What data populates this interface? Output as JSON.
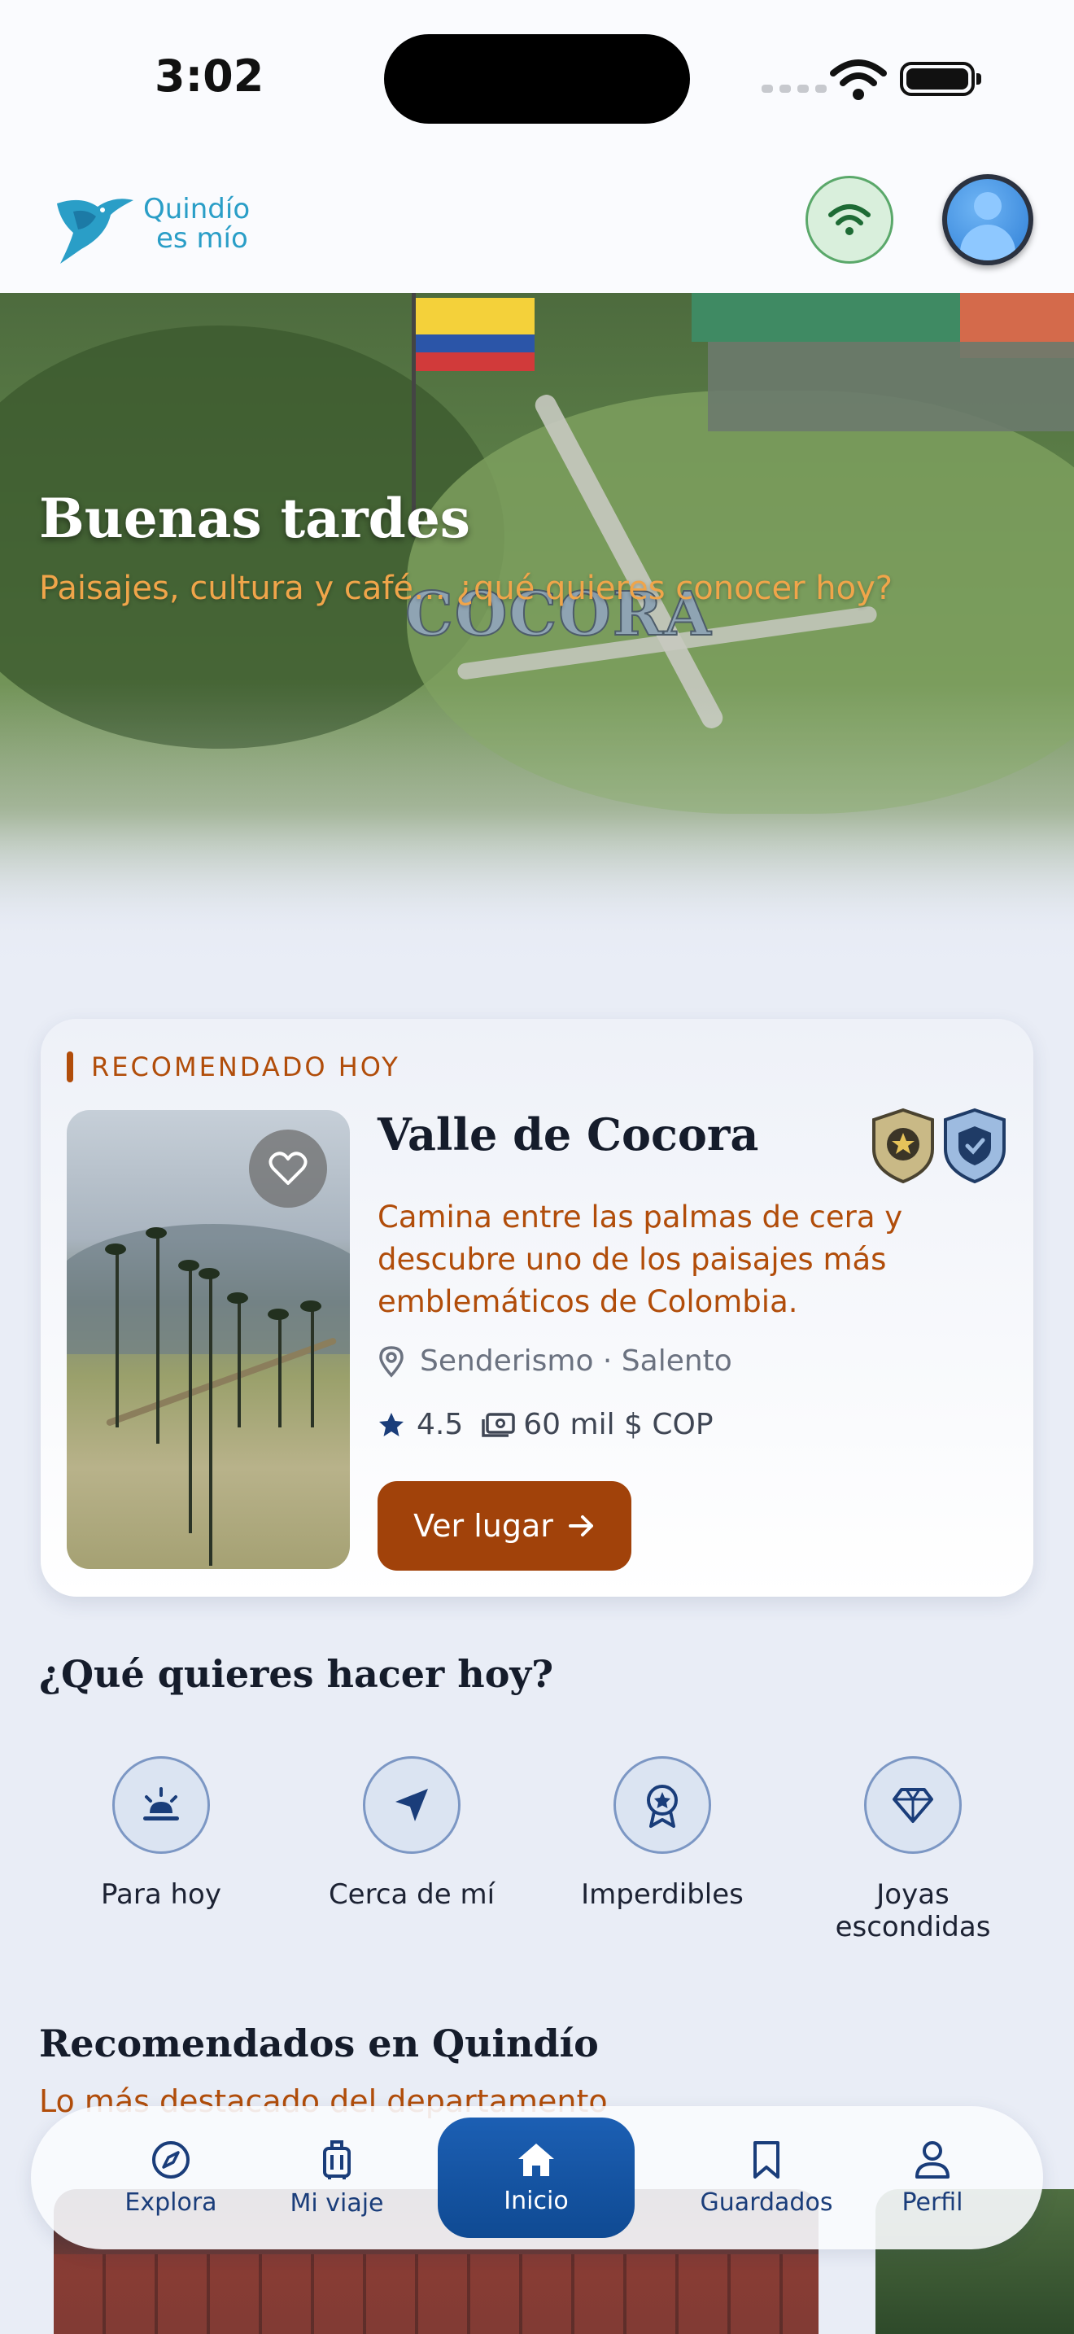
{
  "status_bar": {
    "time": "3:02"
  },
  "header": {
    "logo": {
      "line1": "Quindío",
      "line2": "es mío"
    }
  },
  "hero": {
    "title": "Buenas tardes",
    "subtitle": "Paisajes, cultura y café… ¿qué quieres conocer hoy?",
    "sign_text": "COCORA"
  },
  "recommended": {
    "tag": "RECOMENDADO HOY",
    "title": "Valle de Cocora",
    "description": "Camina entre las palmas de cera y descubre uno de los paisajes más emblemáticos de Colombia.",
    "meta": "Senderismo · Salento",
    "rating": "4.5",
    "price": "60 mil $ COP",
    "button_label": "Ver lugar"
  },
  "quick_actions": {
    "title": "¿Qué quieres hacer hoy?",
    "items": [
      {
        "label": "Para hoy",
        "icon": "sunset-icon"
      },
      {
        "label": "Cerca de mí",
        "icon": "navigation-arrow-icon"
      },
      {
        "label": "Imperdibles",
        "icon": "award-ribbon-icon"
      },
      {
        "label": "Joyas escondidas",
        "icon": "diamond-icon"
      }
    ]
  },
  "section": {
    "title": "Recomendados en Quindío",
    "subtitle": "Lo más destacado del departamento"
  },
  "tabbar": {
    "items": [
      {
        "label": "Explora",
        "icon": "compass-icon"
      },
      {
        "label": "Mi viaje",
        "icon": "luggage-icon"
      },
      {
        "label": "Inicio",
        "icon": "home-icon",
        "active": true
      },
      {
        "label": "Guardados",
        "icon": "bookmark-icon"
      },
      {
        "label": "Perfil",
        "icon": "person-icon"
      }
    ]
  },
  "colors": {
    "accent_orange": "#b14d0a",
    "button_brown": "#a1420a",
    "nav_blue": "#1a3d7a",
    "active_tab": "#1c5fb3",
    "logo_teal": "#2a9ec7"
  }
}
